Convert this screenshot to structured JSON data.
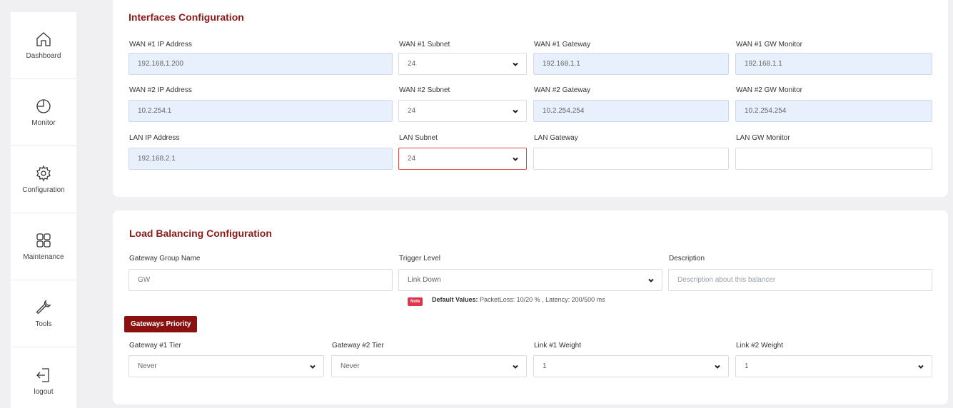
{
  "sidebar": {
    "items": [
      {
        "label": "Dashboard",
        "icon": "home-icon"
      },
      {
        "label": "Monitor",
        "icon": "pie-chart-icon"
      },
      {
        "label": "Configuration",
        "icon": "gear-icon"
      },
      {
        "label": "Maintenance",
        "icon": "grid-icon"
      },
      {
        "label": "Tools",
        "icon": "wrench-icon"
      },
      {
        "label": "logout",
        "icon": "logout-icon"
      }
    ]
  },
  "interfaces": {
    "title": "Interfaces Configuration",
    "rows": [
      {
        "ip_label": "WAN #1 IP Address",
        "ip_value": "192.168.1.200",
        "subnet_label": "WAN #1 Subnet",
        "subnet_value": "24",
        "gateway_label": "WAN #1 Gateway",
        "gateway_value": "192.168.1.1",
        "monitor_label": "WAN #1 GW Monitor",
        "monitor_value": "192.168.1.1"
      },
      {
        "ip_label": "WAN #2 IP Address",
        "ip_value": "10.2.254.1",
        "subnet_label": "WAN #2 Subnet",
        "subnet_value": "24",
        "gateway_label": "WAN #2 Gateway",
        "gateway_value": "10.2.254.254",
        "monitor_label": "WAN #2 GW Monitor",
        "monitor_value": "10.2.254.254"
      },
      {
        "ip_label": "LAN IP Address",
        "ip_value": "192.168.2.1",
        "subnet_label": "LAN Subnet",
        "subnet_value": "24",
        "gateway_label": "LAN Gateway",
        "gateway_value": "",
        "monitor_label": "LAN GW Monitor",
        "monitor_value": ""
      }
    ]
  },
  "load_balancing": {
    "title": "Load Balancing Configuration",
    "group_name_label": "Gateway Group Name",
    "group_name_value": "GW",
    "trigger_label": "Trigger Level",
    "trigger_value": "Link Down",
    "description_label": "Description",
    "description_placeholder": "Description about this balancer",
    "note_tag": "Note",
    "note_bold": "Default Values:",
    "note_text": "PacketLoss: 10/20 % , Latency: 200/500 ms",
    "priority_button": "Gateways Priority",
    "gw1_tier_label": "Gateway #1 Tier",
    "gw1_tier_value": "Never",
    "gw2_tier_label": "Gateway #2 Tier",
    "gw2_tier_value": "Never",
    "link1_weight_label": "Link #1 Weight",
    "link1_weight_value": "1",
    "link2_weight_label": "Link #2 Weight",
    "link2_weight_value": "1"
  },
  "colors": {
    "accent": "#8b1a1a",
    "filled_input": "#e8f0fe",
    "note_tag": "#e0364b"
  }
}
